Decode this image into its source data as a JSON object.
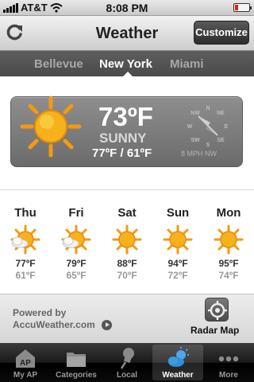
{
  "status_bar": {
    "carrier": "AT&T",
    "time": "8:08 PM",
    "battery_level": 0.2
  },
  "nav": {
    "title": "Weather",
    "customize_label": "Customize"
  },
  "cities": [
    {
      "name": "Bellevue",
      "active": false
    },
    {
      "name": "New York",
      "active": true
    },
    {
      "name": "Miami",
      "active": false
    }
  ],
  "current": {
    "temp": "73ºF",
    "condition": "SUNNY",
    "hilo": "77ºF / 61ºF",
    "wind": "8 MPH NW",
    "compass_labels": [
      "N",
      "NE",
      "E",
      "SE",
      "S",
      "SW",
      "W",
      "NW"
    ]
  },
  "forecast": [
    {
      "day": "Thu",
      "high": "77ºF",
      "low": "61ºF",
      "icon": "partly-sunny-icon"
    },
    {
      "day": "Fri",
      "high": "79ºF",
      "low": "65ºF",
      "icon": "partly-sunny-icon"
    },
    {
      "day": "Sat",
      "high": "88ºF",
      "low": "70ºF",
      "icon": "sunny-icon"
    },
    {
      "day": "Sun",
      "high": "94ºF",
      "low": "72ºF",
      "icon": "sunny-icon"
    },
    {
      "day": "Mon",
      "high": "95ºF",
      "low": "74ºF",
      "icon": "sunny-icon"
    }
  ],
  "footer": {
    "powered_by": "Powered by",
    "source": "AccuWeather.com",
    "radar_label": "Radar Map"
  },
  "tabs": [
    {
      "label": "My AP",
      "icon": "ap-icon",
      "selected": false
    },
    {
      "label": "Categories",
      "icon": "folder-icon",
      "selected": false
    },
    {
      "label": "Local",
      "icon": "pushpin-icon",
      "selected": false
    },
    {
      "label": "Weather",
      "icon": "weather-icon",
      "selected": true
    },
    {
      "label": "More",
      "icon": "more-dots-icon",
      "selected": false
    }
  ],
  "colors": {
    "sun_core": "#f7b21b",
    "sun_ray": "#f39a12",
    "accent_dark": "#2c2c2c",
    "battery": "#dd2211"
  }
}
